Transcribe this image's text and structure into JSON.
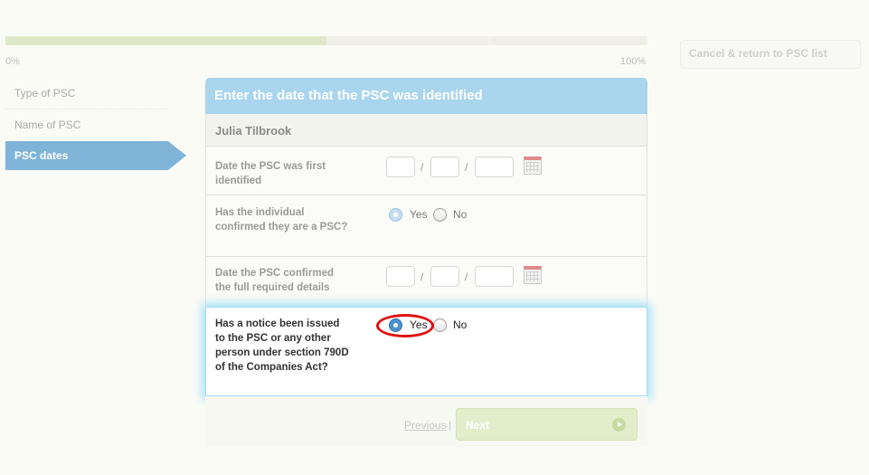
{
  "progress": {
    "percent": 50,
    "label_start": "0%",
    "label_end": "100%"
  },
  "cancel_button": "Cancel & return to PSC list",
  "steps": [
    {
      "label": "Type of PSC"
    },
    {
      "label": "Name of PSC"
    },
    {
      "label": "PSC dates",
      "active": true
    }
  ],
  "panel": {
    "title": "Enter the date that the PSC was identified",
    "person": "Julia Tilbrook"
  },
  "fields": {
    "identified_date": {
      "label": "Date the PSC was first identified",
      "day": "",
      "month": "",
      "year": "",
      "separator": "/"
    },
    "confirmed_psc": {
      "label": "Has the individual confirmed they are a PSC?",
      "options": [
        "Yes",
        "No"
      ],
      "selected": "Yes"
    },
    "confirmed_date": {
      "label": "Date the PSC confirmed the full required details",
      "day": "",
      "month": "",
      "year": "",
      "separator": "/"
    },
    "notice_issued": {
      "label": "Has a notice been issued to the PSC or any other person under section 790D of the Companies Act?",
      "options": [
        "Yes",
        "No"
      ],
      "selected": "Yes"
    }
  },
  "footer": {
    "previous": "Previous",
    "pipe": "|",
    "next": "Next"
  },
  "colors": {
    "accent": "#a9d5ee",
    "active_step": "#7fb4d8",
    "highlight_glow": "#a9e3f7",
    "annotation": "#e01010"
  }
}
